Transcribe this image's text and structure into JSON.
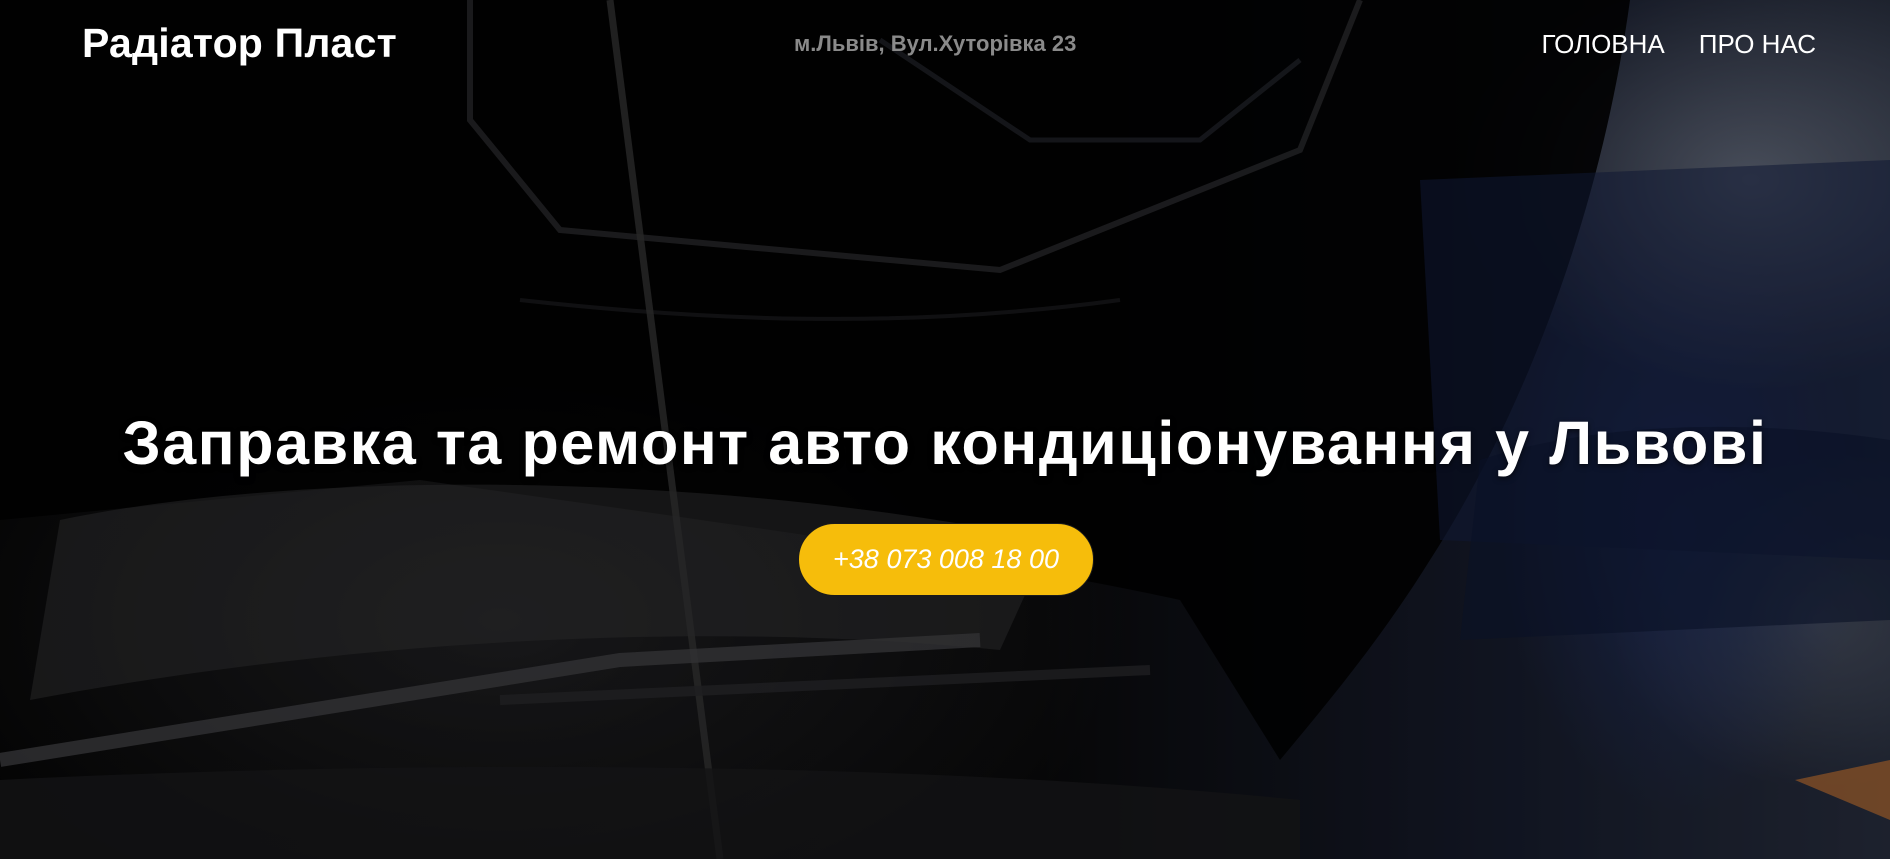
{
  "header": {
    "brand": "Радіатор Пласт",
    "address": "м.Львів, Вул.Хуторівка 23",
    "nav": [
      {
        "label": "ГОЛОВНА"
      },
      {
        "label": "ПРО НАС"
      }
    ]
  },
  "hero": {
    "headline": "Заправка та ремонт авто кондиціонування у Львові",
    "phone_button": "+38 073 008 18 00"
  },
  "colors": {
    "accent": "#f6bd0b",
    "address_text": "#8a8a8a",
    "text": "#ffffff"
  }
}
